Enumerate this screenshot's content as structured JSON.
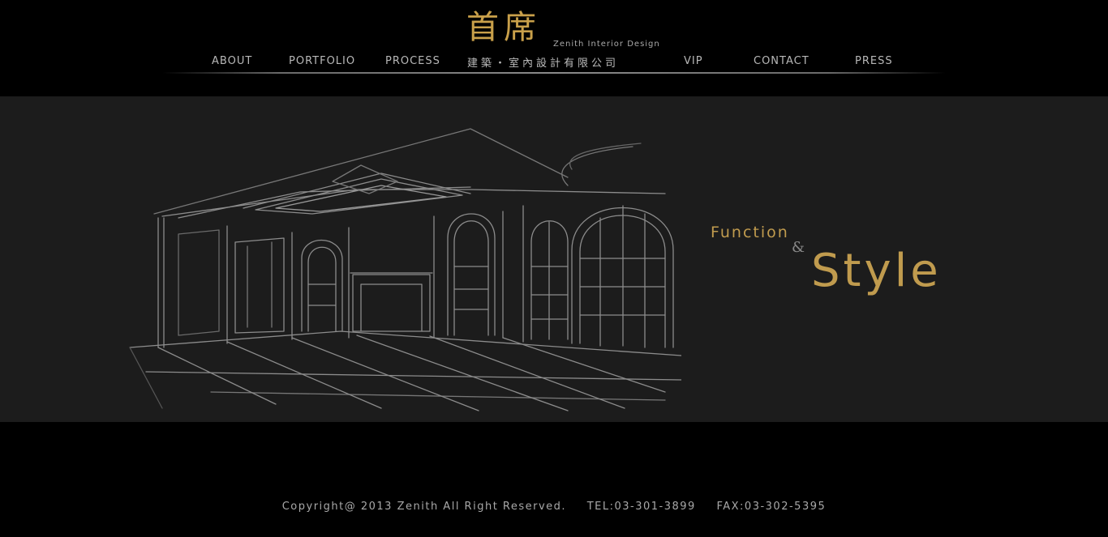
{
  "nav": {
    "items": [
      {
        "label": "ABOUT"
      },
      {
        "label": "PORTFOLIO"
      },
      {
        "label": "PROCESS"
      },
      {
        "label": "VIP"
      },
      {
        "label": "CONTACT"
      },
      {
        "label": "PRESS"
      }
    ]
  },
  "logo": {
    "name_cn": "首席",
    "name_en": "Zenith Interior Design",
    "subtitle_cn": "建築・室內設計有限公司"
  },
  "banner": {
    "word_function": "Function",
    "word_and": "&",
    "word_style": "Style"
  },
  "footer": {
    "copyright": "Copyright@ 2013 Zenith All Right Reserved.",
    "tel": "TEL:03-301-3899",
    "fax": "FAX:03-302-5395"
  },
  "colors": {
    "gold": "#c09b4e",
    "banner_bg": "#1c1c1c",
    "page_bg": "#000000"
  }
}
